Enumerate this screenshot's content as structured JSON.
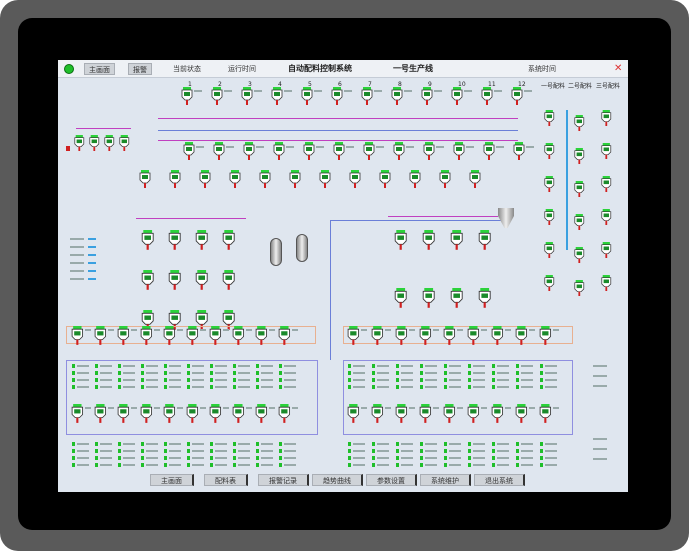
{
  "header": {
    "title": "自动配料控制系统",
    "subtitle": "一号生产线",
    "nav_buttons": [
      "主画面",
      "报警"
    ],
    "info_left": "当前状态",
    "info_mid": "运行时间",
    "info_right": "系统时间"
  },
  "columns": [
    "1",
    "2",
    "3",
    "4",
    "5",
    "6",
    "7",
    "8",
    "9",
    "10",
    "11",
    "12"
  ],
  "right_headers": [
    "一号配料",
    "二号配料",
    "三号配料"
  ],
  "footer_buttons": [
    "主画面",
    "配料表",
    "报警记录",
    "趋势曲线",
    "参数设置",
    "系统维护",
    "退出系统"
  ],
  "colors": {
    "background": "#dfe6ef",
    "active": "#1fbf2a",
    "alarm": "#d02020",
    "pipe": "#6a7fd8"
  },
  "icons": [
    "status-led-icon",
    "close-icon",
    "mixer-icon",
    "tank-icon",
    "hopper-icon"
  ]
}
